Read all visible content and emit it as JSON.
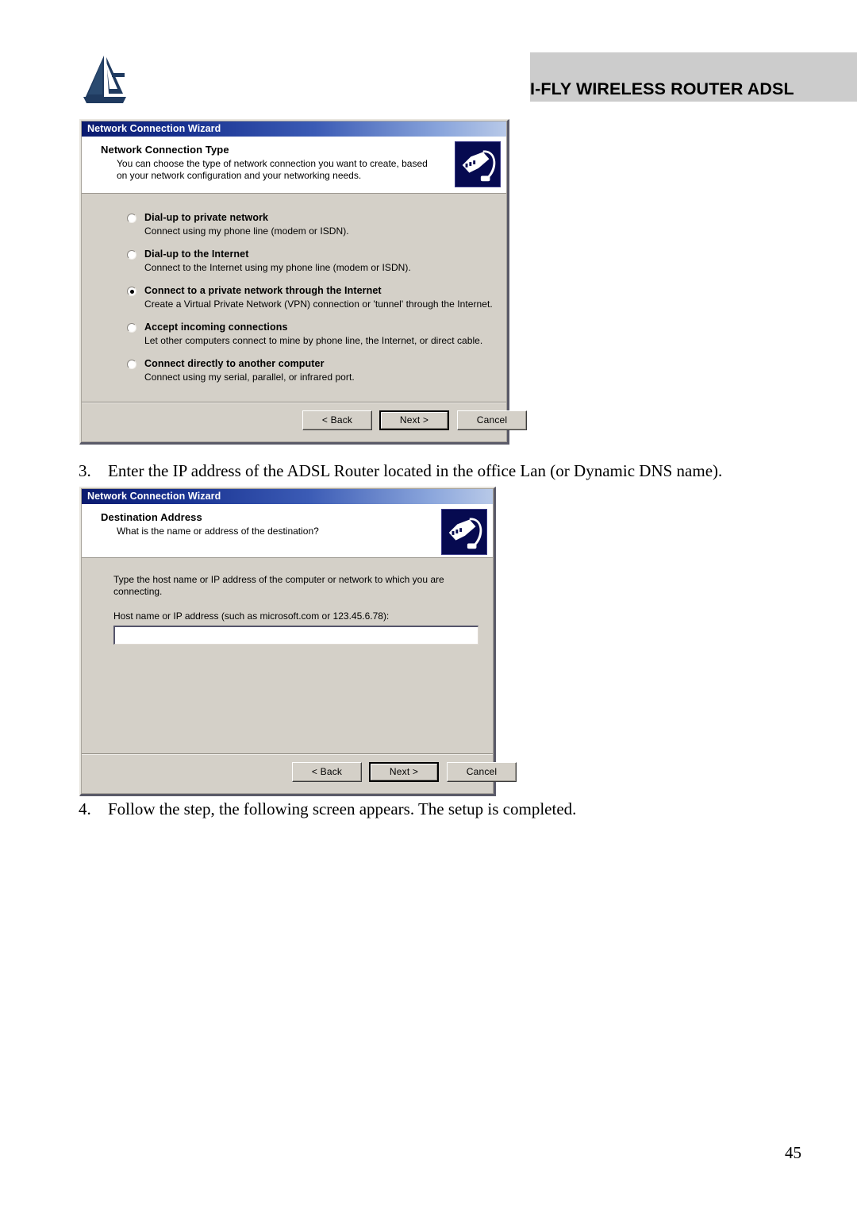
{
  "header": {
    "logo_alt": "atlantis-land-logo",
    "banner_title": "I-FLY WIRELESS ROUTER ADSL",
    "banner_bg": "#cccccc"
  },
  "dialog1": {
    "titlebar": "Network Connection Wizard",
    "header_title": "Network Connection Type",
    "header_subtitle": "You can choose the type of network connection you want to create, based on your network configuration and your networking needs.",
    "icon_name": "network-plug-icon",
    "options": [
      {
        "label": "Dial-up to private network",
        "description": "Connect using my phone line (modem or ISDN).",
        "selected": false
      },
      {
        "label": "Dial-up to the Internet",
        "description": "Connect to the Internet using my phone line (modem or ISDN).",
        "selected": false
      },
      {
        "label": "Connect to a private network through the Internet",
        "description": "Create a Virtual Private Network (VPN) connection or 'tunnel' through the Internet.",
        "selected": true
      },
      {
        "label": "Accept incoming connections",
        "description": "Let other computers connect to mine by phone line, the Internet, or direct cable.",
        "selected": false
      },
      {
        "label": "Connect directly to another computer",
        "description": "Connect using my serial, parallel, or infrared port.",
        "selected": false
      }
    ],
    "buttons": {
      "back": "< Back",
      "next": "Next >",
      "cancel": "Cancel"
    }
  },
  "step3": {
    "number": "3.",
    "text": "Enter the IP address of the ADSL Router located in the office Lan  (or Dynamic DNS name)."
  },
  "dialog2": {
    "titlebar": "Network Connection Wizard",
    "header_title": "Destination Address",
    "header_subtitle": "What is the name or address of the destination?",
    "icon_name": "network-plug-icon",
    "instruction": "Type the host name or IP address of the computer or network to which you are connecting.",
    "field_label": "Host name or IP address (such as microsoft.com or 123.45.6.78):",
    "field_value": "",
    "buttons": {
      "back": "< Back",
      "next": "Next >",
      "cancel": "Cancel"
    }
  },
  "step4": {
    "number": "4.",
    "text": "Follow the step, the following screen appears. The setup is completed."
  },
  "footer": {
    "page_number": "45"
  }
}
